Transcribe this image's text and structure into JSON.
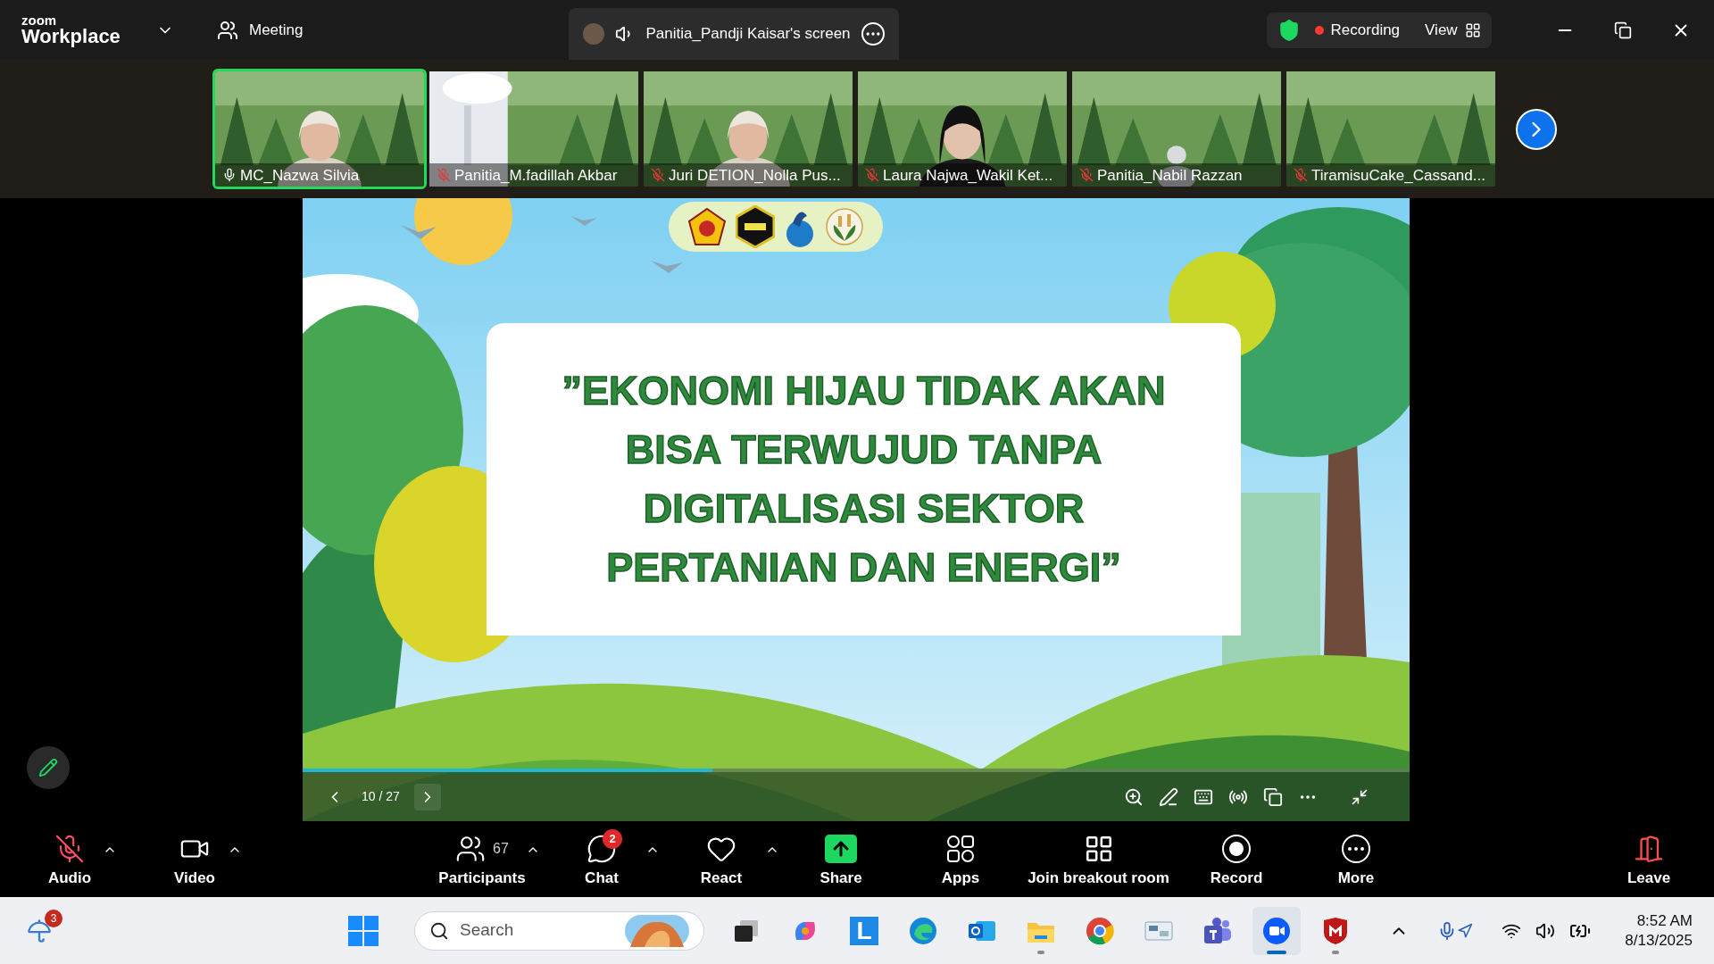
{
  "app": {
    "brand_top": "zoom",
    "brand": "Workplace"
  },
  "meeting_menu": {
    "label": "Meeting"
  },
  "share_tab": {
    "label": "Panitia_Pandji Kaisar's screen"
  },
  "status": {
    "recording": "Recording",
    "view": "View"
  },
  "participants": [
    {
      "name": "MC_Nazwa Silvia",
      "muted": false,
      "selected": true
    },
    {
      "name": "Panitia_M.fadillah Akbar",
      "muted": true,
      "selected": false
    },
    {
      "name": "Juri DETION_Nolla Pus...",
      "muted": true,
      "selected": false
    },
    {
      "name": "Laura Najwa_Wakil Ket...",
      "muted": true,
      "selected": false
    },
    {
      "name": "Panitia_Nabil Razzan",
      "muted": true,
      "selected": false
    },
    {
      "name": "TiramisuCake_Cassand...",
      "muted": true,
      "selected": false
    }
  ],
  "slide": {
    "quote_lines": [
      "”EKONOMI HIJAU TIDAK AKAN",
      "BISA TERWUJUD TANPA",
      "DIGITALISASI SEKTOR",
      "PERTANIAN DAN ENERGI”"
    ],
    "page": "10 / 27",
    "level": 0.37
  },
  "toolbar": [
    {
      "kind": "audio",
      "label": "Audio",
      "muted": true,
      "menu": true
    },
    {
      "kind": "video",
      "label": "Video",
      "menu": true
    },
    {
      "kind": "participants",
      "label": "Participants",
      "count": "67",
      "menu": true
    },
    {
      "kind": "chat",
      "label": "Chat",
      "badge": "2",
      "menu": true
    },
    {
      "kind": "react",
      "label": "React",
      "menu": true
    },
    {
      "kind": "share",
      "label": "Share",
      "menu": false
    },
    {
      "kind": "apps",
      "label": "Apps",
      "menu": false
    },
    {
      "kind": "breakout",
      "label": "Join breakout room",
      "menu": false
    },
    {
      "kind": "record",
      "label": "Record",
      "menu": false
    },
    {
      "kind": "more",
      "label": "More",
      "menu": false
    },
    {
      "kind": "leave",
      "label": "Leave",
      "menu": false
    }
  ],
  "taskbar": {
    "weather_badge": "3",
    "search_placeholder": "Search",
    "apps": [
      {
        "kind": "taskview",
        "running": false,
        "active": false
      },
      {
        "kind": "copilot",
        "running": false,
        "active": false
      },
      {
        "kind": "letter",
        "glyph": "L",
        "running": false,
        "active": false
      },
      {
        "kind": "edge",
        "running": false,
        "active": false
      },
      {
        "kind": "outlook",
        "running": false,
        "active": false
      },
      {
        "kind": "explorer",
        "running": true,
        "active": false
      },
      {
        "kind": "chrome",
        "running": false,
        "active": false
      },
      {
        "kind": "tool",
        "running": false,
        "active": false
      },
      {
        "kind": "teams",
        "running": false,
        "active": false
      },
      {
        "kind": "zoom",
        "running": true,
        "active": true
      },
      {
        "kind": "shield",
        "running": true,
        "active": false
      }
    ],
    "time": "8:52 AM",
    "date": "8/13/2025"
  }
}
